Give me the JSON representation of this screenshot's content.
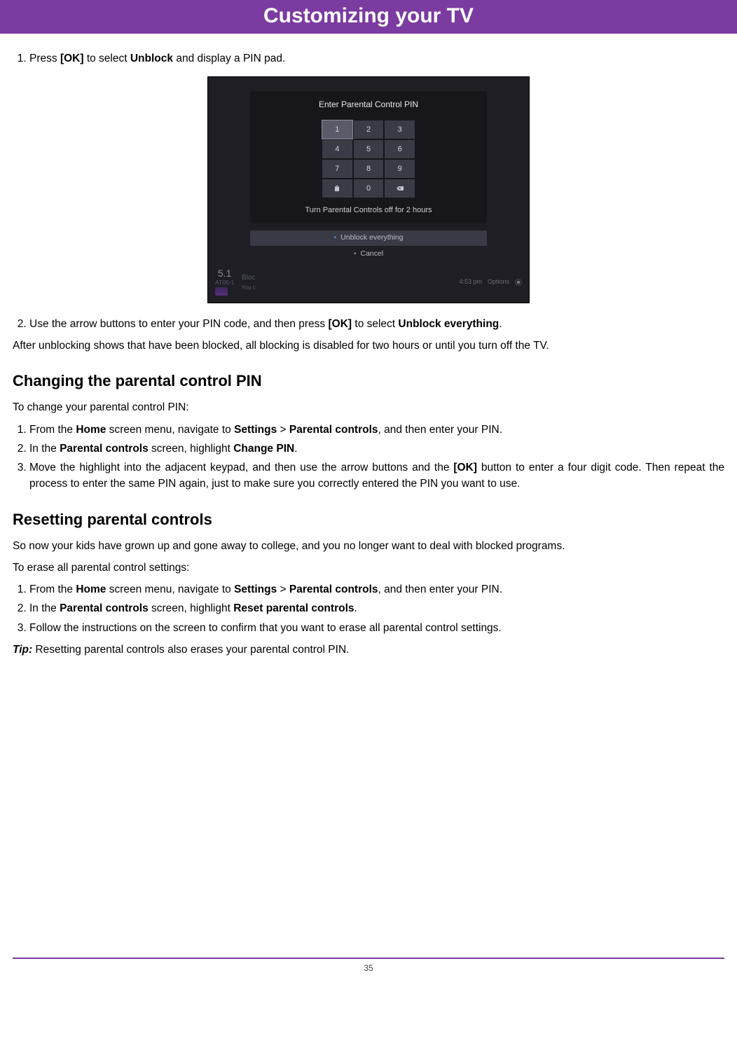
{
  "header": {
    "title": "Customizing your TV"
  },
  "intro_list": {
    "item1_pre": "Press ",
    "item1_k1": "[OK]",
    "item1_mid": " to select ",
    "item1_k2": "Unblock",
    "item1_post": " and display a PIN pad."
  },
  "figure": {
    "dialog_title": "Enter Parental Control PIN",
    "keys": {
      "r1c1": "1",
      "r1c2": "2",
      "r1c3": "3",
      "r2c1": "4",
      "r2c2": "5",
      "r2c3": "6",
      "r3c1": "7",
      "r3c2": "8",
      "r3c3": "9",
      "r4c2": "0"
    },
    "subtitle": "Turn Parental Controls off for 2 hours",
    "opt1": "Unblock everything",
    "opt2": "Cancel",
    "channel_num": "5.1",
    "channel_call": "AT05-1",
    "block_word": "Bloc",
    "block_sub": "You c",
    "time": "4:53 pm",
    "options": "Options"
  },
  "intro_list2": {
    "item2_pre": "Use the arrow buttons to enter your PIN code, and then press ",
    "item2_k1": "[OK]",
    "item2_mid": " to select ",
    "item2_k2": "Unblock everything",
    "item2_post": "."
  },
  "after_unblock": "After unblocking shows that have been blocked, all blocking is disabled for two hours or until you turn off the TV.",
  "sec1": {
    "heading": "Changing the parental control PIN",
    "intro": "To change your parental control PIN:",
    "i1_pre": "From the ",
    "i1_b1": "Home",
    "i1_mid1": " screen menu, navigate to ",
    "i1_b2": "Settings",
    "i1_gt": " > ",
    "i1_b3": "Parental controls",
    "i1_post": ", and then enter your PIN.",
    "i2_pre": "In the ",
    "i2_b1": "Parental controls",
    "i2_mid": " screen, highlight ",
    "i2_b2": "Change PIN",
    "i2_post": ".",
    "i3_pre": "Move the highlight into the adjacent keypad, and then use the arrow buttons and the ",
    "i3_b1": "[OK]",
    "i3_post": " button to enter a four digit code. Then repeat the process to enter the same PIN again, just to make sure you correctly entered the PIN you want to use."
  },
  "sec2": {
    "heading": "Resetting parental controls",
    "p1": "So now your kids have grown up and gone away to college, and you no longer want to deal with blocked programs.",
    "p2": "To erase all parental control settings:",
    "i1_pre": "From the ",
    "i1_b1": "Home",
    "i1_mid1": " screen menu, navigate to ",
    "i1_b2": "Settings",
    "i1_gt": " > ",
    "i1_b3": "Parental controls",
    "i1_post": ", and then enter your PIN.",
    "i2_pre": "In the ",
    "i2_b1": "Parental controls",
    "i2_mid": " screen, highlight ",
    "i2_b2": "Reset parental controls",
    "i2_post": ".",
    "i3": "Follow the instructions on the screen to confirm that you want to erase all parental control settings.",
    "tip_label": "Tip:",
    "tip_text": " Resetting parental controls also erases your parental control PIN."
  },
  "page_number": "35"
}
